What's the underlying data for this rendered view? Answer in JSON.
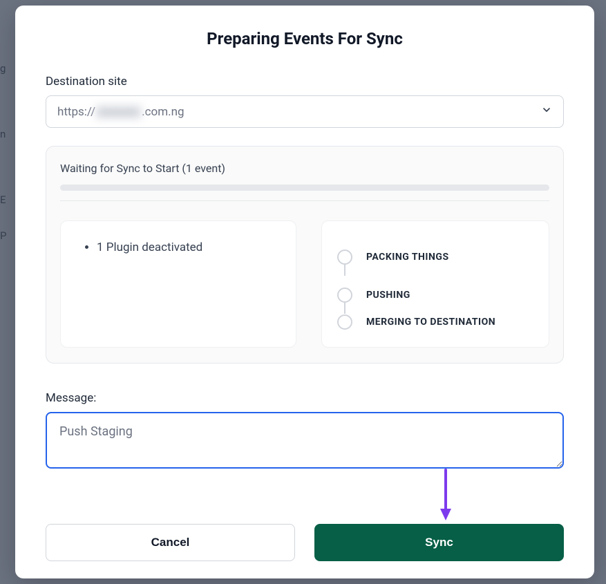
{
  "modal": {
    "title": "Preparing Events For Sync",
    "destination": {
      "label": "Destination site",
      "prefix": "https://",
      "suffix": ".com.ng"
    },
    "status": {
      "title": "Waiting for Sync to Start (1 event)",
      "events": [
        "1 Plugin deactivated"
      ],
      "steps": [
        "PACKING THINGS",
        "PUSHING",
        "MERGING TO DESTINATION"
      ]
    },
    "message": {
      "label": "Message:",
      "value": "Push Staging"
    },
    "buttons": {
      "cancel": "Cancel",
      "sync": "Sync"
    }
  },
  "colors": {
    "accent_arrow": "#7c3aed",
    "sync_button": "#065f46"
  }
}
